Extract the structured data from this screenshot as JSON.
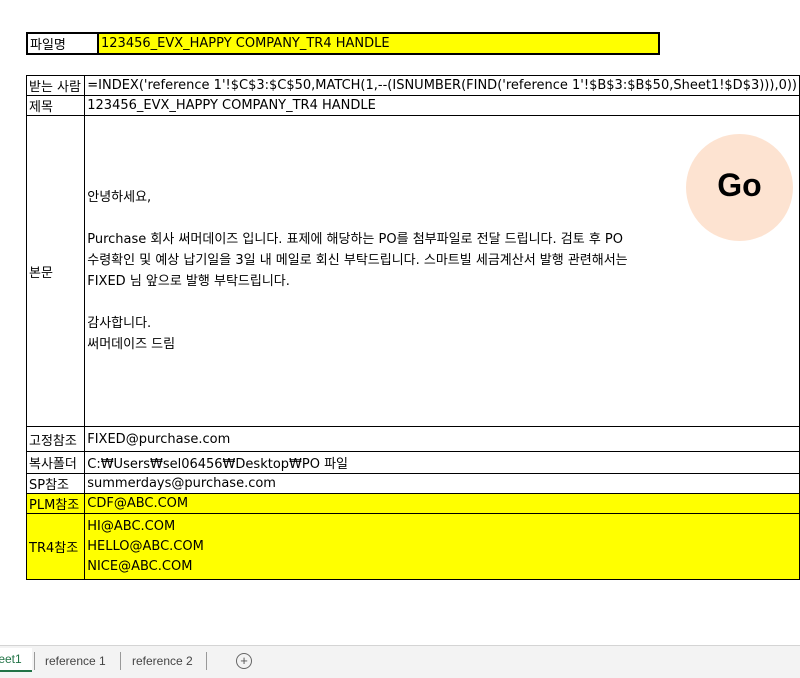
{
  "file": {
    "label": "파일명",
    "value": "123456_EVX_HAPPY COMPANY_TR4 HANDLE"
  },
  "rows": {
    "recipient": {
      "label": "받는 사람",
      "value": "=INDEX('reference 1'!$C$3:$C$50,MATCH(1,--(ISNUMBER(FIND('reference 1'!$B$3:$B$50,Sheet1!$D$3))),0))"
    },
    "subject": {
      "label": "제목",
      "value": "123456_EVX_HAPPY COMPANY_TR4 HANDLE"
    },
    "body": {
      "label": "본문",
      "greeting": "안녕하세요,",
      "paragraph": "Purchase 회사 써머데이즈 입니다. 표제에 해당하는 PO를 첨부파일로 전달 드립니다. 검토 후 PO 수령확인 및 예상 납기일을 3일 내 메일로 회신 부탁드립니다. 스마트빌 세금계산서 발행 관련해서는 FIXED 님 앞으로 발행 부탁드립니다.",
      "closing1": "감사합니다.",
      "closing2": "써머데이즈 드림"
    },
    "fixed_cc": {
      "label": "고정참조",
      "value": "FIXED@purchase.com"
    },
    "copy_folder": {
      "label": "복사폴더",
      "value": "C:₩Users₩sel06456₩Desktop₩PO 파일"
    },
    "sp_cc": {
      "label": "SP참조",
      "value": "summerdays@purchase.com"
    },
    "plm_cc": {
      "label": "PLM참조",
      "value": "CDF@ABC.COM"
    },
    "tr4_cc": {
      "label": "TR4참조",
      "values": [
        "HI@ABC.COM",
        "HELLO@ABC.COM",
        "NICE@ABC.COM"
      ]
    }
  },
  "go_button": {
    "label": "Go"
  },
  "sheet_tabs": [
    "eet1",
    "reference 1",
    "reference 2"
  ],
  "colors": {
    "highlight": "#ffff00",
    "go_button": "#fde3d1",
    "active_tab": "#217346"
  }
}
